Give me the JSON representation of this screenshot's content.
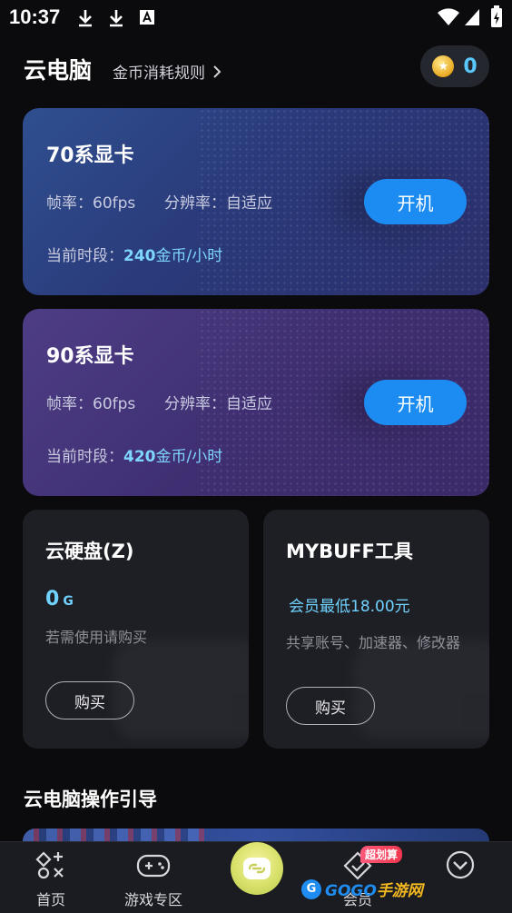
{
  "status_bar": {
    "time": "10:37"
  },
  "header": {
    "title": "云电脑",
    "rules_link": "金币消耗规则",
    "coin_count": "0"
  },
  "gpu_cards": [
    {
      "name": "70系显卡",
      "fps_label": "帧率：60fps",
      "resolution_label": "分辨率：自适应",
      "period_prefix": "当前时段：",
      "price": "240",
      "price_unit": "金币/小时",
      "button": "开机"
    },
    {
      "name": "90系显卡",
      "fps_label": "帧率：60fps",
      "resolution_label": "分辨率：自适应",
      "period_prefix": "当前时段：",
      "price": "420",
      "price_unit": "金币/小时",
      "button": "开机"
    }
  ],
  "cloud_disk": {
    "title": "云硬盘(Z)",
    "value": "0",
    "unit": "G",
    "note": "若需使用请购买",
    "button": "购买"
  },
  "mybuff": {
    "title": "MYBUFF工具",
    "member_price": "会员最低18.00元",
    "note": "共享账号、加速器、修改器",
    "button": "购买"
  },
  "guide": {
    "title": "云电脑操作引导"
  },
  "tabbar": {
    "home": "首页",
    "games": "游戏专区",
    "member": "会员",
    "deal_badge": "超划算"
  },
  "watermark": {
    "logo": "G",
    "text_a": "GOGO",
    "text_b": "手游网"
  },
  "colors": {
    "accent_blue": "#1c8cf2",
    "price_cyan": "#7ed6ff",
    "background": "#0b0b0d"
  }
}
